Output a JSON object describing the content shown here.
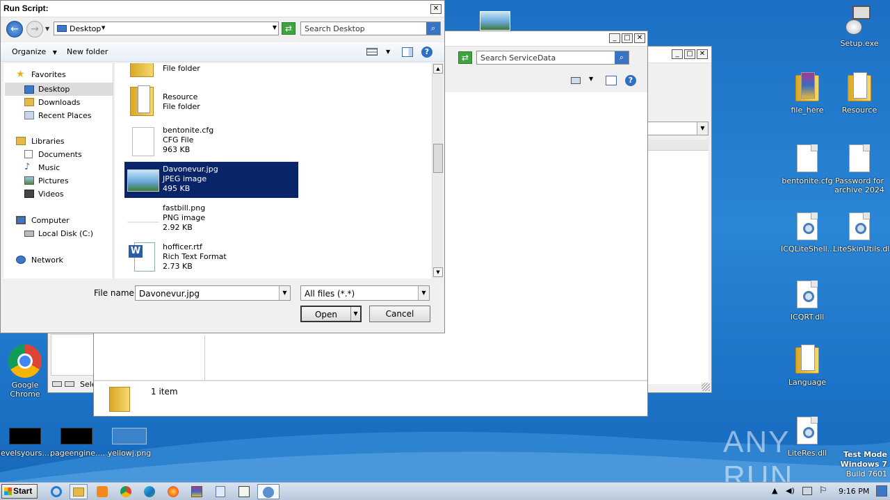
{
  "dialog": {
    "title": "Run Script:",
    "address": "Desktop",
    "search_placeholder": "Search Desktop",
    "toolbar": {
      "organize": "Organize",
      "new_folder": "New folder"
    },
    "nav": {
      "favorites": "Favorites",
      "desktop": "Desktop",
      "downloads": "Downloads",
      "recent_places": "Recent Places",
      "libraries": "Libraries",
      "documents": "Documents",
      "music": "Music",
      "pictures": "Pictures",
      "videos": "Videos",
      "computer": "Computer",
      "local_disk": "Local Disk (C:)",
      "network": "Network"
    },
    "files": [
      {
        "name": "",
        "type": "File folder",
        "size": ""
      },
      {
        "name": "Resource",
        "type": "File folder",
        "size": ""
      },
      {
        "name": "bentonite.cfg",
        "type": "CFG File",
        "size": "963 KB"
      },
      {
        "name": "Davonevur.jpg",
        "type": "JPEG image",
        "size": "495 KB"
      },
      {
        "name": "fastbill.png",
        "type": "PNG image",
        "size": "2.92 KB"
      },
      {
        "name": "hofficer.rtf",
        "type": "Rich Text Format",
        "size": "2.73 KB"
      }
    ],
    "file_name_label": "File name:",
    "file_name_value": "Davonevur.jpg",
    "file_type": "All files (*.*)",
    "open_label": "Open",
    "cancel_label": "Cancel"
  },
  "explorer": {
    "search_placeholder": "Search ServiceData",
    "status": "1 item"
  },
  "explorer2": {
    "status_fragment": "Sele"
  },
  "desktop_icons": {
    "setup": "Setup.exe",
    "file_here": "file_here",
    "resource": "Resource",
    "bentonite": "bentonite.cfg",
    "password": "Password for archive 2024",
    "icqliteshell": "ICQLiteShell....",
    "liteskinutils": "LiteSkinUtils.dll",
    "icqrt": "ICQRT.dll",
    "language": "Language",
    "literes": "LiteRes.dll",
    "chrome": "Google Chrome",
    "levelsyours": "levelsyours....",
    "pageengine": "pageengine....",
    "yellowj": "yellowj.png"
  },
  "watermark": {
    "brand": "ANY RUN",
    "test_mode": "Test Mode",
    "os": "Windows 7",
    "build": "Build 7601"
  },
  "taskbar": {
    "start": "Start",
    "clock": "9:16 PM"
  },
  "colors": {
    "selection": "#0a246a",
    "desktop": "#1f78cc"
  }
}
